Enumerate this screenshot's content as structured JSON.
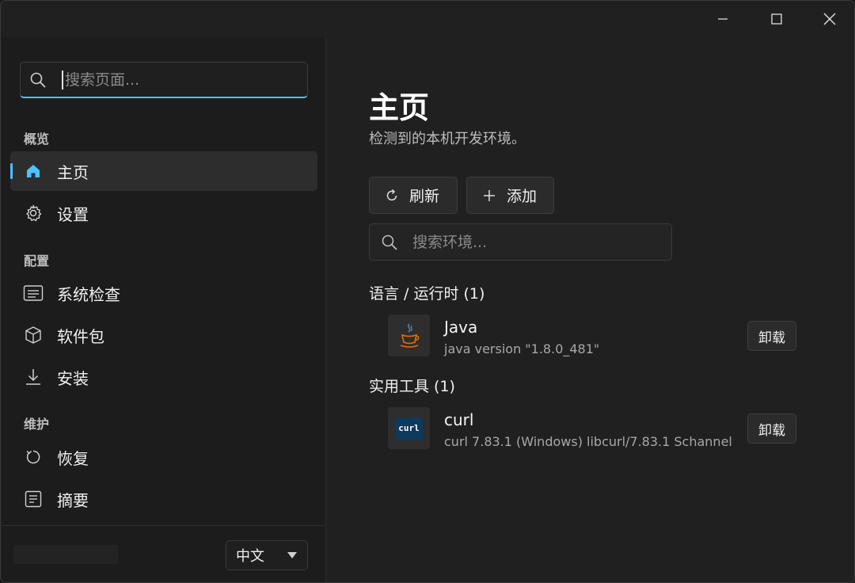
{
  "window": {
    "controls": {
      "minimize": "minimize-icon",
      "maximize": "maximize-icon",
      "close": "close-icon"
    }
  },
  "sidebar": {
    "search_placeholder": "搜索页面...",
    "sections": [
      {
        "label": "概览",
        "items": [
          {
            "label": "主页",
            "icon": "home-icon",
            "active": true
          },
          {
            "label": "设置",
            "icon": "gear-icon"
          }
        ]
      },
      {
        "label": "配置",
        "items": [
          {
            "label": "系统检查",
            "icon": "list-icon"
          },
          {
            "label": "软件包",
            "icon": "package-icon"
          },
          {
            "label": "安装",
            "icon": "download-icon"
          }
        ]
      },
      {
        "label": "维护",
        "items": [
          {
            "label": "恢复",
            "icon": "restore-icon"
          },
          {
            "label": "摘要",
            "icon": "summary-icon"
          }
        ]
      }
    ],
    "language": {
      "selected": "中文"
    }
  },
  "main": {
    "title": "主页",
    "subtitle": "检测到的本机开发环境。",
    "refresh_label": "刷新",
    "add_label": "添加",
    "search_placeholder": "搜索环境...",
    "groups": [
      {
        "label": "语言 / 运行时 (1)",
        "items": [
          {
            "name": "Java",
            "version": "java version \"1.8.0_481\"",
            "icon": "java-icon",
            "action": "卸载"
          }
        ]
      },
      {
        "label": "实用工具 (1)",
        "items": [
          {
            "name": "curl",
            "version": "curl 7.83.1 (Windows) libcurl/7.83.1 Schannel",
            "icon": "curl-icon",
            "badge": "curl",
            "action": "卸载"
          }
        ]
      }
    ]
  },
  "colors": {
    "accent": "#4cc2ff",
    "background": "#202020",
    "sidebar": "#1c1c1c"
  }
}
